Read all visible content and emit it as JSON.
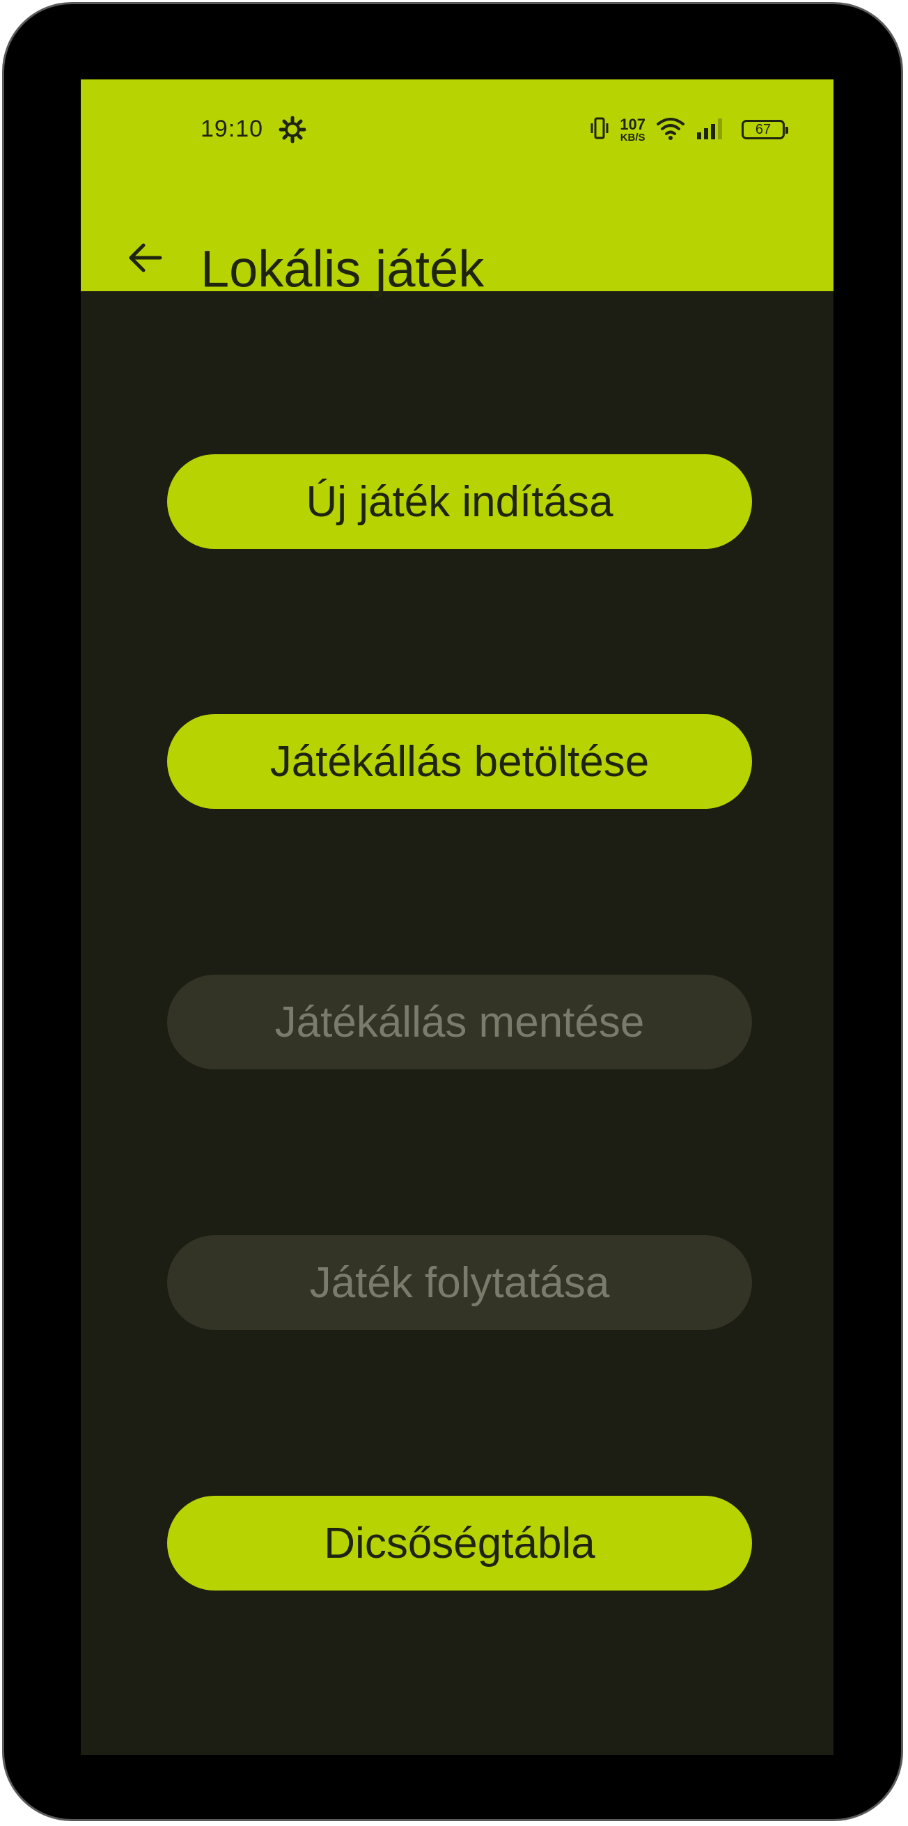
{
  "status_bar": {
    "time": "19:10",
    "net_speed_value": "107",
    "net_speed_unit": "KB/S",
    "battery_level": "67",
    "icons": [
      "settings-gear-icon",
      "vibrate-icon",
      "wifi-icon",
      "signal-icon",
      "battery-icon"
    ]
  },
  "app_bar": {
    "title": "Lokális játék",
    "back_icon": "arrow-back-icon"
  },
  "menu": {
    "buttons": [
      {
        "label": "Új játék indítása",
        "enabled": true
      },
      {
        "label": "Játékállás betöltése",
        "enabled": true
      },
      {
        "label": "Játékállás mentése",
        "enabled": false
      },
      {
        "label": "Játék folytatása",
        "enabled": false
      },
      {
        "label": "Dicsőségtábla",
        "enabled": true
      }
    ]
  },
  "colors": {
    "accent": "#b7d302",
    "background": "#1c1d13",
    "on_accent_text": "#1f2410",
    "disabled_button": "#333426",
    "disabled_text": "#7a7b6a"
  }
}
